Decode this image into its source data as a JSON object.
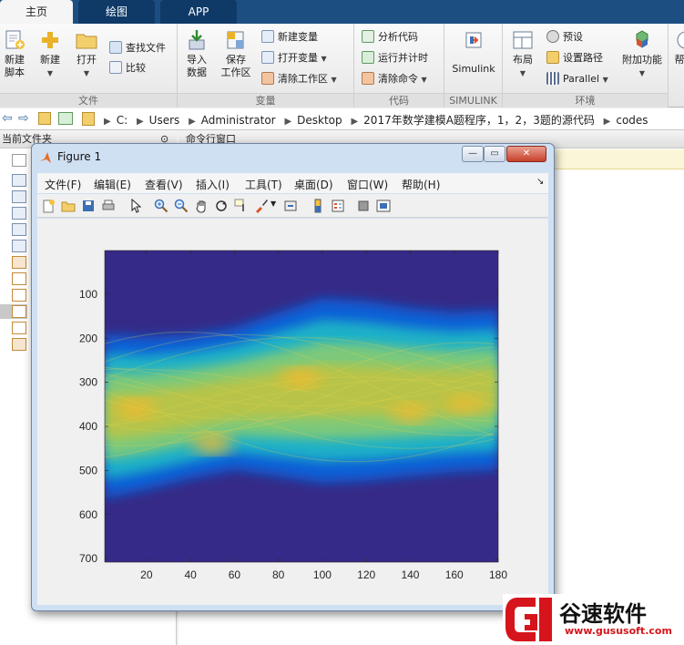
{
  "tabs": [
    "主页",
    "绘图",
    "APP"
  ],
  "ribbon": {
    "file": {
      "label": "文件",
      "new_script": [
        "新建",
        "脚本"
      ],
      "new": "新建",
      "open": "打开",
      "find_files": "查找文件",
      "compare": "比较"
    },
    "variable": {
      "label": "变量",
      "import": [
        "导入",
        "数据"
      ],
      "save": [
        "保存",
        "工作区"
      ],
      "new_var": "新建变量",
      "open_var": "打开变量",
      "clear_ws": "清除工作区"
    },
    "code": {
      "label": "代码",
      "analyze": "分析代码",
      "run_time": "运行并计时",
      "clear_cmd": "清除命令"
    },
    "simulink": {
      "label": "SIMULINK",
      "btn": "Simulink"
    },
    "env": {
      "label": "环境",
      "layout": "布局",
      "prefs": "预设",
      "path": "设置路径",
      "parallel": "Parallel",
      "addons": "附加功能"
    },
    "help_cut": "帮"
  },
  "address": {
    "crumbs": [
      "C:",
      "Users",
      "Administrator",
      "Desktop",
      "2017年数学建模A题程序，1，2，3题的源代码",
      "codes"
    ]
  },
  "panels": {
    "current_folder": "当前文件夹",
    "command_window": "命令行窗口"
  },
  "figure": {
    "title": "Figure 1",
    "menu": [
      "文件(F)",
      "编辑(E)",
      "查看(V)",
      "插入(I)",
      "工具(T)",
      "桌面(D)",
      "窗口(W)",
      "帮助(H)"
    ]
  },
  "chart_data": {
    "type": "heatmap",
    "title": "",
    "xlabel": "",
    "ylabel": "",
    "xlim": [
      1,
      180
    ],
    "ylim": [
      1,
      708
    ],
    "y_reversed": true,
    "xticks": [
      20,
      40,
      60,
      80,
      100,
      120,
      140,
      160,
      180
    ],
    "yticks": [
      100,
      200,
      300,
      400,
      500,
      600,
      700
    ],
    "colormap": "parula",
    "background_value_color": "#352a87",
    "band": {
      "x": [
        1,
        20,
        40,
        60,
        80,
        100,
        120,
        140,
        160,
        180
      ],
      "upper_edge": [
        200,
        205,
        200,
        185,
        150,
        118,
        125,
        140,
        150,
        145
      ],
      "lower_edge": [
        555,
        535,
        510,
        490,
        505,
        520,
        515,
        505,
        495,
        490
      ]
    },
    "hot_spots": [
      {
        "x": 15,
        "y": 360,
        "level": 0.85
      },
      {
        "x": 50,
        "y": 440,
        "level": 0.9
      },
      {
        "x": 90,
        "y": 290,
        "level": 0.85
      },
      {
        "x": 140,
        "y": 370,
        "level": 0.8
      },
      {
        "x": 165,
        "y": 350,
        "level": 0.75
      }
    ]
  },
  "watermark": {
    "name": "谷速软件",
    "url": "www.gususoft.com"
  }
}
